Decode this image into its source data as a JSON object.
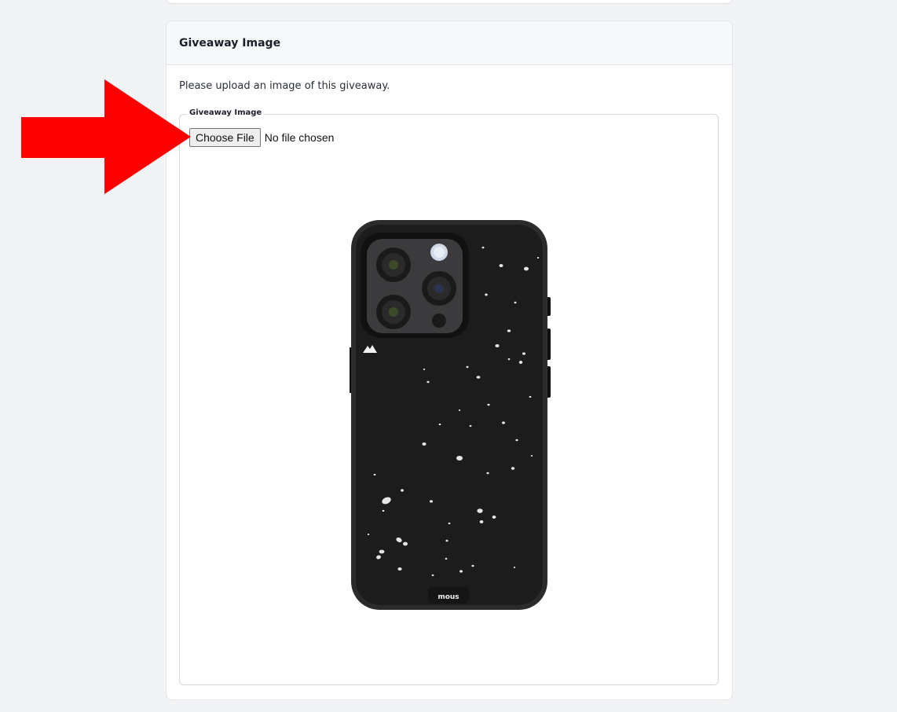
{
  "card": {
    "title": "Giveaway Image",
    "description": "Please upload an image of this giveaway."
  },
  "upload_field": {
    "legend": "Giveaway Image",
    "button_label": "Choose File",
    "status": "No file chosen"
  },
  "preview": {
    "alt": "Speckled black phone case with triple-camera cutout",
    "brand_mark": "mous",
    "colors": {
      "case": "#1c1c1c",
      "speckle": "#e6e6e6",
      "camera_module": "#3b3b3d"
    }
  },
  "annotation": {
    "arrow_color": "#ff0000",
    "arrow_icon": "arrow-right-icon"
  }
}
